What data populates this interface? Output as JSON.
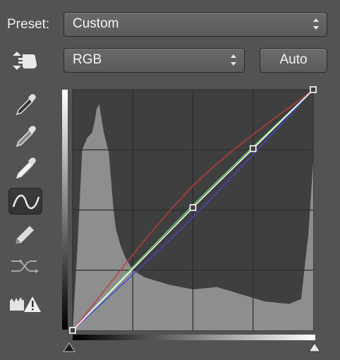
{
  "preset": {
    "label": "Preset:",
    "value": "Custom"
  },
  "channel": {
    "value": "RGB"
  },
  "auto_button": {
    "label": "Auto"
  },
  "tools": [
    {
      "name": "on-image-adjust-icon",
      "selected": false
    },
    {
      "name": "black-point-eyedropper-icon",
      "selected": false
    },
    {
      "name": "gray-point-eyedropper-icon",
      "selected": false
    },
    {
      "name": "white-point-eyedropper-icon",
      "selected": false
    },
    {
      "name": "curve-points-icon",
      "selected": true
    },
    {
      "name": "pencil-icon",
      "selected": false
    },
    {
      "name": "smooth-curve-icon",
      "selected": false
    },
    {
      "name": "clipping-warning-icon",
      "selected": false
    }
  ],
  "colors": {
    "panel": "#535353",
    "graph_bg": "#3f3f3f",
    "histogram": "#8e8e8e",
    "composite_curve": "#ffffff",
    "red_curve": "#c53a3a",
    "green_curve": "#6ad16a",
    "blue_curve": "#4646d6"
  },
  "curves": {
    "composite_points": [
      [
        0,
        0
      ],
      [
        0.5,
        0.51
      ],
      [
        0.75,
        0.755
      ],
      [
        1,
        1
      ]
    ],
    "red_points": [
      [
        0,
        0
      ],
      [
        0.5,
        0.6
      ],
      [
        1,
        1
      ]
    ],
    "green_points": [
      [
        0,
        0
      ],
      [
        0.5,
        0.52
      ],
      [
        1,
        1
      ]
    ],
    "blue_points": [
      [
        0,
        0
      ],
      [
        0.5,
        0.47
      ],
      [
        1,
        1
      ]
    ]
  },
  "histogram_profile": [
    [
      0.0,
      0.0
    ],
    [
      0.02,
      0.35
    ],
    [
      0.04,
      0.75
    ],
    [
      0.06,
      0.8
    ],
    [
      0.08,
      0.82
    ],
    [
      0.09,
      0.86
    ],
    [
      0.1,
      0.92
    ],
    [
      0.11,
      0.94
    ],
    [
      0.12,
      0.88
    ],
    [
      0.13,
      0.82
    ],
    [
      0.14,
      0.78
    ],
    [
      0.15,
      0.74
    ],
    [
      0.16,
      0.62
    ],
    [
      0.17,
      0.5
    ],
    [
      0.18,
      0.42
    ],
    [
      0.2,
      0.35
    ],
    [
      0.22,
      0.3
    ],
    [
      0.25,
      0.25
    ],
    [
      0.3,
      0.22
    ],
    [
      0.4,
      0.19
    ],
    [
      0.5,
      0.17
    ],
    [
      0.6,
      0.18
    ],
    [
      0.7,
      0.15
    ],
    [
      0.8,
      0.12
    ],
    [
      0.9,
      0.11
    ],
    [
      0.95,
      0.13
    ],
    [
      0.98,
      0.4
    ],
    [
      1.0,
      0.7
    ]
  ]
}
